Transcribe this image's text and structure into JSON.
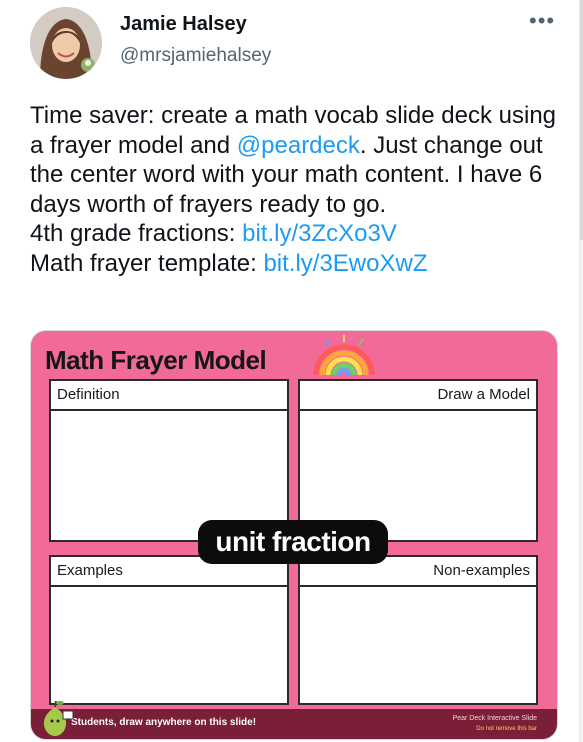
{
  "author": {
    "name": "Jamie Halsey",
    "handle": "@mrsjamiehalsey"
  },
  "menu_glyph": "•••",
  "tweet": {
    "line1_pre": "Time saver: create a math vocab slide deck using a frayer model and ",
    "mention": "@peardeck",
    "line1_post": ". Just change out the center word with your math content. I have 6 days worth of frayers ready to go.",
    "line2_label": "4th grade fractions: ",
    "line2_link": "bit.ly/3ZcXo3V",
    "line3_label": "Math frayer template: ",
    "line3_link": "bit.ly/3EwoXwZ"
  },
  "slide": {
    "title": "Math Frayer Model",
    "definition_label": "Definition",
    "model_label": "Draw a Model",
    "examples_label": "Examples",
    "nonexamples_label": "Non-examples",
    "center_word": "unit fraction",
    "footer_left": "Students, draw anywhere on this slide!",
    "footer_right_1": "Pear Deck Interactive Slide",
    "footer_right_2": "Do not remove this bar"
  },
  "colors": {
    "link": "#1d9bf0",
    "slide_bg": "#f26a98",
    "footer_bg": "#7a1f37"
  }
}
